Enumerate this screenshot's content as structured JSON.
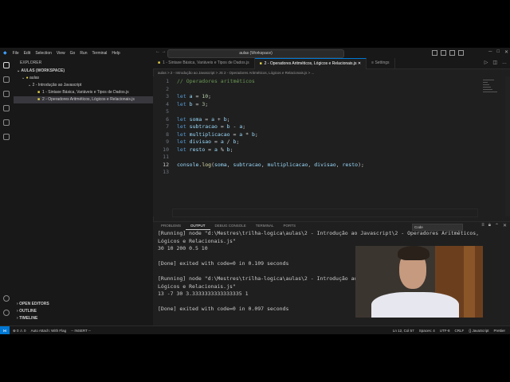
{
  "menu": [
    "File",
    "Edit",
    "Selection",
    "View",
    "Go",
    "Run",
    "Terminal",
    "Help"
  ],
  "command_center": "aulas (Workspace)",
  "explorer": {
    "title": "EXPLORER",
    "workspace": "AULAS (WORKSPACE)",
    "folder": "aulas",
    "subfolder": "2 - Introdução ao Javascript",
    "files": [
      "1 - Sintaxe Básica, Variáveis e Tipos de Dados.js",
      "2 - Operadores Aritméticos, Lógicos e Relacionais.js"
    ],
    "sections": [
      "OPEN EDITORS",
      "OUTLINE",
      "TIMELINE"
    ]
  },
  "tabs": [
    {
      "label": "1 - Sintaxe Básica, Variáveis e Tipos de Dados.js",
      "active": false
    },
    {
      "label": "2 - Operadores Aritméticos, Lógicos e Relacionais.js",
      "active": true
    },
    {
      "label": "Settings",
      "active": false
    }
  ],
  "breadcrumb": "aulas > 2 - Introdução ao Javascript > JS 2 - Operadores Aritméticos, Lógicos e Relacionais.js > ...",
  "editor": {
    "line_numbers": [
      "1",
      "2",
      "3",
      "4",
      "5",
      "6",
      "7",
      "8",
      "9",
      "10",
      "11",
      "12",
      "13"
    ],
    "lines": [
      "// Operadores aritméticos",
      "",
      "let a = 10;",
      "let b = 3;",
      "",
      "let soma = a + b;",
      "let subtracao = b - a;",
      "let multiplicacao = a * b;",
      "let divisao = a / b;",
      "let resto = a % b;",
      "",
      "console.log(soma, subtracao, multiplicacao, divisao, resto);",
      ""
    ]
  },
  "panel": {
    "tabs": [
      "PROBLEMS",
      "OUTPUT",
      "DEBUG CONSOLE",
      "TERMINAL",
      "PORTS"
    ],
    "active_tab": "OUTPUT",
    "dropdown": "Code",
    "output": [
      "[Running] node \"d:\\Mestres\\trilha-logica\\aulas\\2 - Introdução ao Javascript\\2 - Operadores Aritméticos,",
      "Lógicos e Relacionais.js\"",
      "30 10 200 0.5 10",
      "",
      "[Done] exited with code=0 in 0.109 seconds",
      "",
      "[Running] node \"d:\\Mestres\\trilha-logica\\aulas\\2 - Introdução ao Javascript\\2 - Operadores Aritméticos,",
      "Lógicos e Relacionais.js\"",
      "13 -7 30 3.3333333333333335 1",
      "",
      "[Done] exited with code=0 in 0.097 seconds"
    ]
  },
  "status": {
    "left": [
      "⊗ 0 ⚠ 0",
      "Auto Attach: With Flag",
      "-- INSERT --"
    ],
    "right": [
      "Ln 12, Col 57",
      "Spaces: 4",
      "UTF-8",
      "CRLF",
      "{} JavaScript",
      "Prettier"
    ]
  },
  "colors": {
    "accent": "#0078d4",
    "keyword": "#569cd6",
    "variable": "#9cdcfe",
    "number": "#b5cea8",
    "comment": "#6a9955",
    "function": "#dcdcaa"
  }
}
